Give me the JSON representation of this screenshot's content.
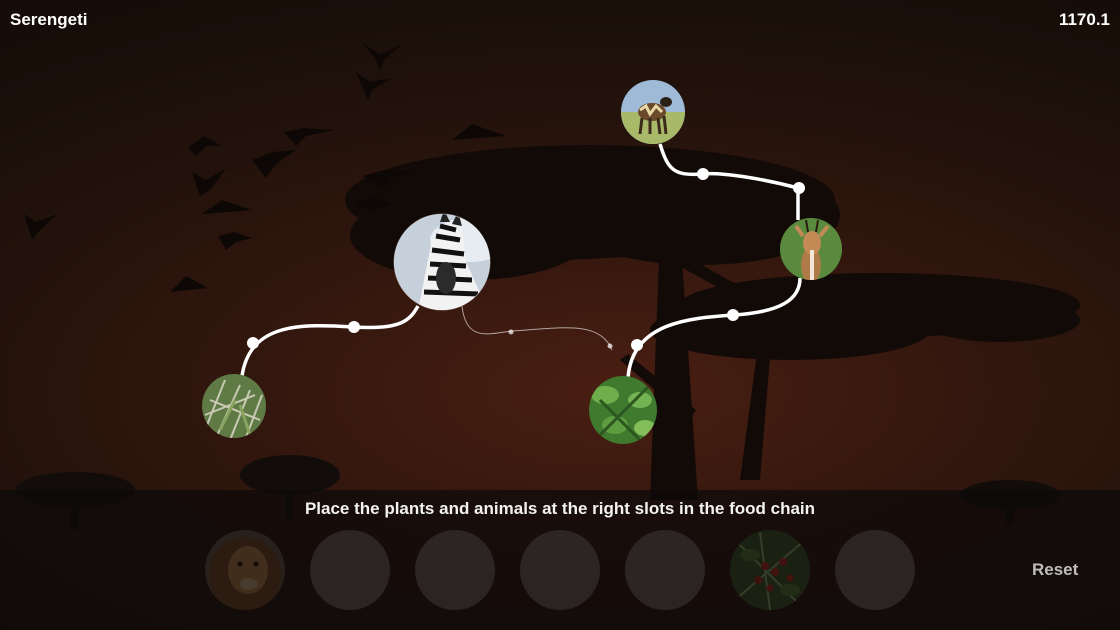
{
  "header": {
    "title": "Serengeti",
    "score": "1170.1"
  },
  "instruction": "Place the plants and animals at the right slots in the food chain",
  "reset_label": "Reset",
  "chain_nodes": [
    {
      "id": "grass",
      "label": "grass-node",
      "state": "placed"
    },
    {
      "id": "zebra",
      "label": "zebra-node",
      "state": "placed-highlighted"
    },
    {
      "id": "shrub",
      "label": "shrub-node",
      "state": "placed"
    },
    {
      "id": "gazelle",
      "label": "gazelle-node",
      "state": "placed"
    },
    {
      "id": "wild-dog",
      "label": "wild-dog-node",
      "state": "placed"
    }
  ],
  "tray_slots": [
    {
      "content": "lion",
      "filled": true
    },
    {
      "content": "",
      "filled": false
    },
    {
      "content": "",
      "filled": false
    },
    {
      "content": "",
      "filled": false
    },
    {
      "content": "",
      "filled": false
    },
    {
      "content": "berry-bush",
      "filled": true
    },
    {
      "content": "",
      "filled": false
    }
  ],
  "colors": {
    "accent": "#ffffff",
    "slot": "#464242",
    "reset": "#bdbdbd"
  }
}
